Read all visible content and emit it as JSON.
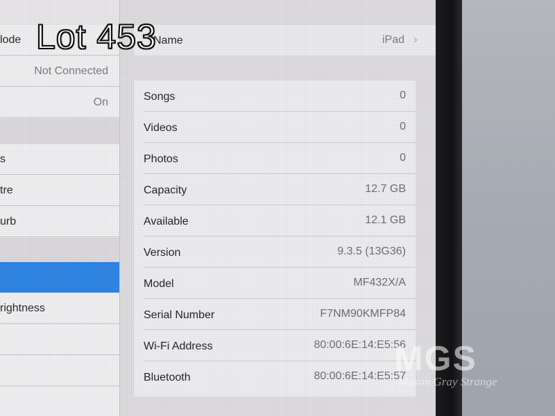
{
  "caption": {
    "lot_label": "Lot 453"
  },
  "master_list": {
    "rows": [
      {
        "label": "lode",
        "value": ""
      },
      {
        "label": "",
        "value": "Not Connected"
      },
      {
        "label": "",
        "value": "On"
      },
      {
        "label": "s",
        "value": ""
      },
      {
        "label": "tre",
        "value": ""
      },
      {
        "label": "urb",
        "value": ""
      },
      {
        "label": "",
        "value": ""
      },
      {
        "label": "rightness",
        "value": ""
      },
      {
        "label": "",
        "value": ""
      }
    ]
  },
  "detail": {
    "name_row": {
      "label": "Name",
      "value": "iPad",
      "chevron": "chevron-right-icon"
    },
    "about_rows": [
      {
        "label": "Songs",
        "value": "0"
      },
      {
        "label": "Videos",
        "value": "0"
      },
      {
        "label": "Photos",
        "value": "0"
      },
      {
        "label": "Capacity",
        "value": "12.7 GB"
      },
      {
        "label": "Available",
        "value": "12.1 GB"
      },
      {
        "label": "Version",
        "value": "9.3.5 (13G36)"
      },
      {
        "label": "Model",
        "value": "MF432X/A"
      },
      {
        "label": "Serial Number",
        "value": "F7NM90KMFP84"
      },
      {
        "label": "Wi-Fi Address",
        "value": "80:00:6E:14:E5:56"
      },
      {
        "label": "Bluetooth",
        "value": "80:00:6E:14:E5:57"
      }
    ]
  },
  "watermark": {
    "logo_text": "MGS",
    "tagline": "Mason Gray Strange"
  },
  "colors": {
    "selected_row": "#2f86e6",
    "secondary_text": "#6f6e73"
  }
}
